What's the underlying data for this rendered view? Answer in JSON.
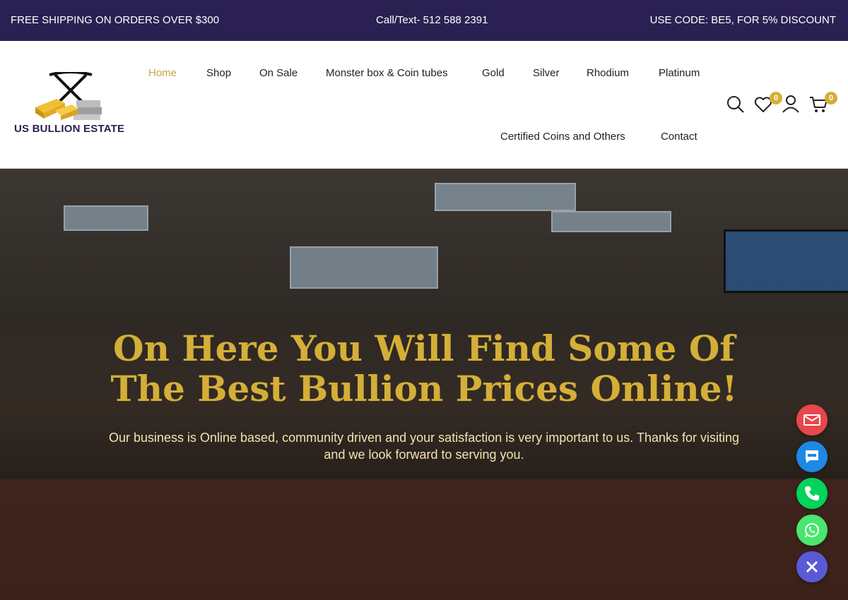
{
  "topbar": {
    "left": "FREE SHIPPING ON ORDERS OVER $300",
    "center": "Call/Text- 512 588 2391",
    "right": "USE CODE: BE5, FOR 5% DISCOUNT"
  },
  "brand": {
    "name": "US BULLION ESTATE"
  },
  "nav": {
    "items": [
      {
        "label": "Home",
        "active": true
      },
      {
        "label": "Shop"
      },
      {
        "label": "On Sale"
      },
      {
        "label": "Monster box & Coin tubes"
      },
      {
        "label": "Gold"
      },
      {
        "label": "Silver"
      },
      {
        "label": "Rhodium"
      },
      {
        "label": "Platinum"
      },
      {
        "label": "Certified Coins and Others"
      },
      {
        "label": "Contact"
      }
    ]
  },
  "header_icons": {
    "search": "search-icon",
    "wishlist": "heart-icon",
    "wishlist_count": "0",
    "account": "user-icon",
    "cart": "cart-icon",
    "cart_count": "0"
  },
  "hero": {
    "title": "On Here You Will Find Some Of The Best Bullion Prices Online!",
    "subtitle": "Our business is Online based, community driven and your satisfaction is very important to us. Thanks for visiting and we look forward to serving you."
  },
  "floating_contacts": [
    {
      "name": "email",
      "icon": "email-icon",
      "color": "#e8474c"
    },
    {
      "name": "sms",
      "icon": "sms-icon",
      "color": "#1e88e5"
    },
    {
      "name": "phone",
      "icon": "phone-icon",
      "color": "#00d45c"
    },
    {
      "name": "whatsapp",
      "icon": "whatsapp-icon",
      "color": "#49e670"
    },
    {
      "name": "close",
      "icon": "close-icon",
      "color": "#5a5ad6"
    }
  ],
  "colors": {
    "topbar_bg": "#2a2152",
    "accent_gold": "#d4af37",
    "nav_active": "#c9a24a"
  }
}
